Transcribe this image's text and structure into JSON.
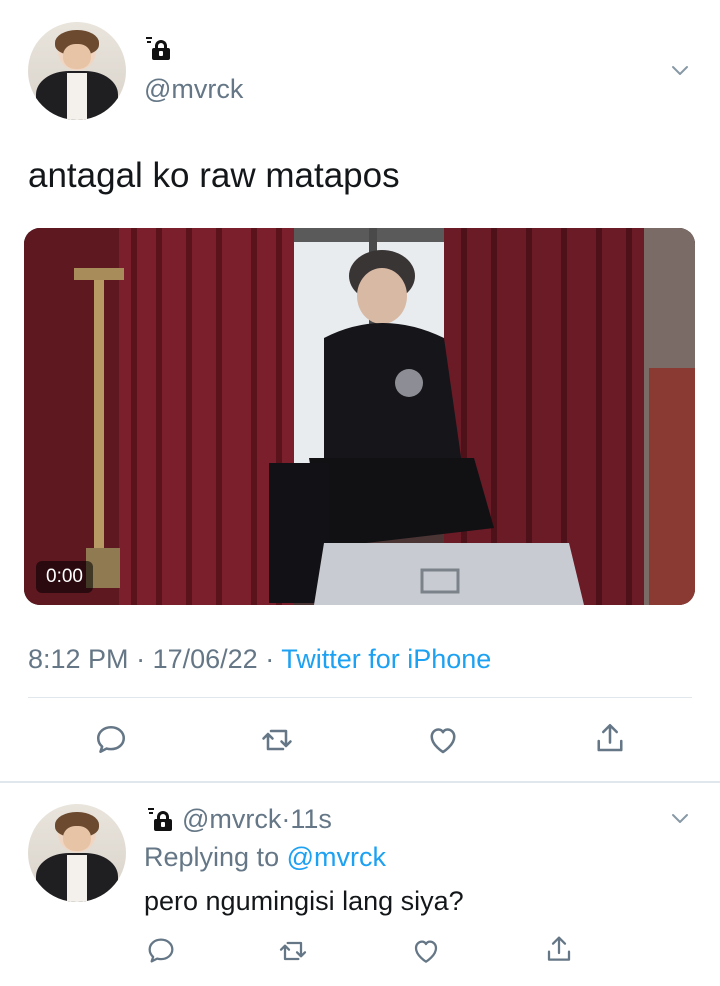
{
  "main_tweet": {
    "handle": "@mvrck",
    "text": "antagal ko raw matapos",
    "media": {
      "video_time": "0:00"
    },
    "meta": {
      "time": "8:12 PM",
      "date": "17/06/22",
      "source": "Twitter for iPhone",
      "separator": "·"
    },
    "actions": {
      "reply": "reply-icon",
      "retweet": "retweet-icon",
      "like": "heart-icon",
      "share": "share-icon"
    }
  },
  "reply_tweet": {
    "handle": "@mvrck",
    "time_ago": "11s",
    "replying_label": "Replying to",
    "replying_to": "@mvrck",
    "text": "pero ngumingisi lang siya?",
    "separator": "·"
  },
  "colors": {
    "link": "#1da1f2",
    "secondary_text": "#657786",
    "divider": "#e1e8ed"
  }
}
